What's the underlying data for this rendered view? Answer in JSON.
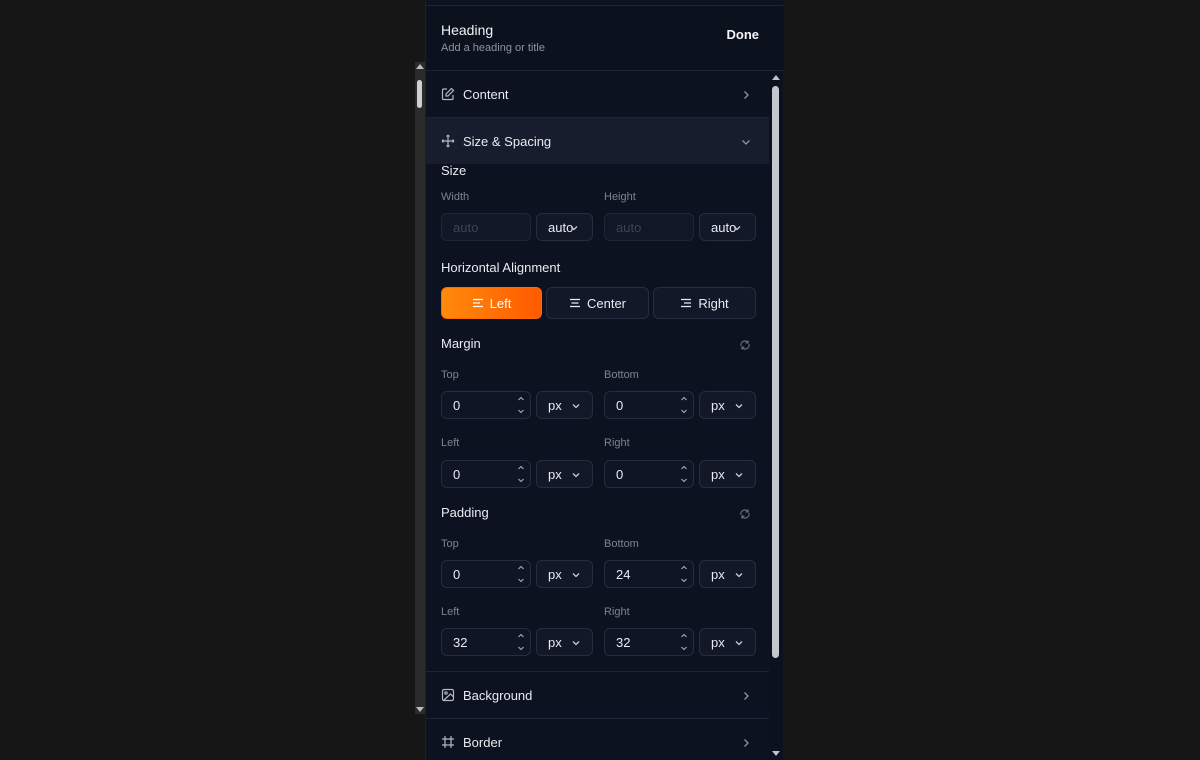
{
  "header": {
    "title": "Heading",
    "subtitle": "Add a heading or title",
    "done_label": "Done"
  },
  "sections": {
    "content": {
      "label": "Content",
      "icon": "edit-icon"
    },
    "size_spacing": {
      "label": "Size & Spacing",
      "icon": "move-icon"
    },
    "background": {
      "label": "Background",
      "icon": "image-icon"
    },
    "border": {
      "label": "Border",
      "icon": "frame-icon"
    }
  },
  "size": {
    "label": "Size",
    "width": {
      "label": "Width",
      "placeholder": "auto",
      "unit": "auto"
    },
    "height": {
      "label": "Height",
      "placeholder": "auto",
      "unit": "auto"
    }
  },
  "alignment": {
    "label": "Horizontal Alignment",
    "options": [
      "Left",
      "Center",
      "Right"
    ],
    "selected": "Left",
    "accent": "#ff6a00"
  },
  "margin": {
    "label": "Margin",
    "top": {
      "label": "Top",
      "value": "0",
      "unit": "px"
    },
    "bottom": {
      "label": "Bottom",
      "value": "0",
      "unit": "px"
    },
    "left": {
      "label": "Left",
      "value": "0",
      "unit": "px"
    },
    "right": {
      "label": "Right",
      "value": "0",
      "unit": "px"
    }
  },
  "padding": {
    "label": "Padding",
    "top": {
      "label": "Top",
      "value": "0",
      "unit": "px"
    },
    "bottom": {
      "label": "Bottom",
      "value": "24",
      "unit": "px"
    },
    "left": {
      "label": "Left",
      "value": "32",
      "unit": "px"
    },
    "right": {
      "label": "Right",
      "value": "32",
      "unit": "px"
    }
  }
}
